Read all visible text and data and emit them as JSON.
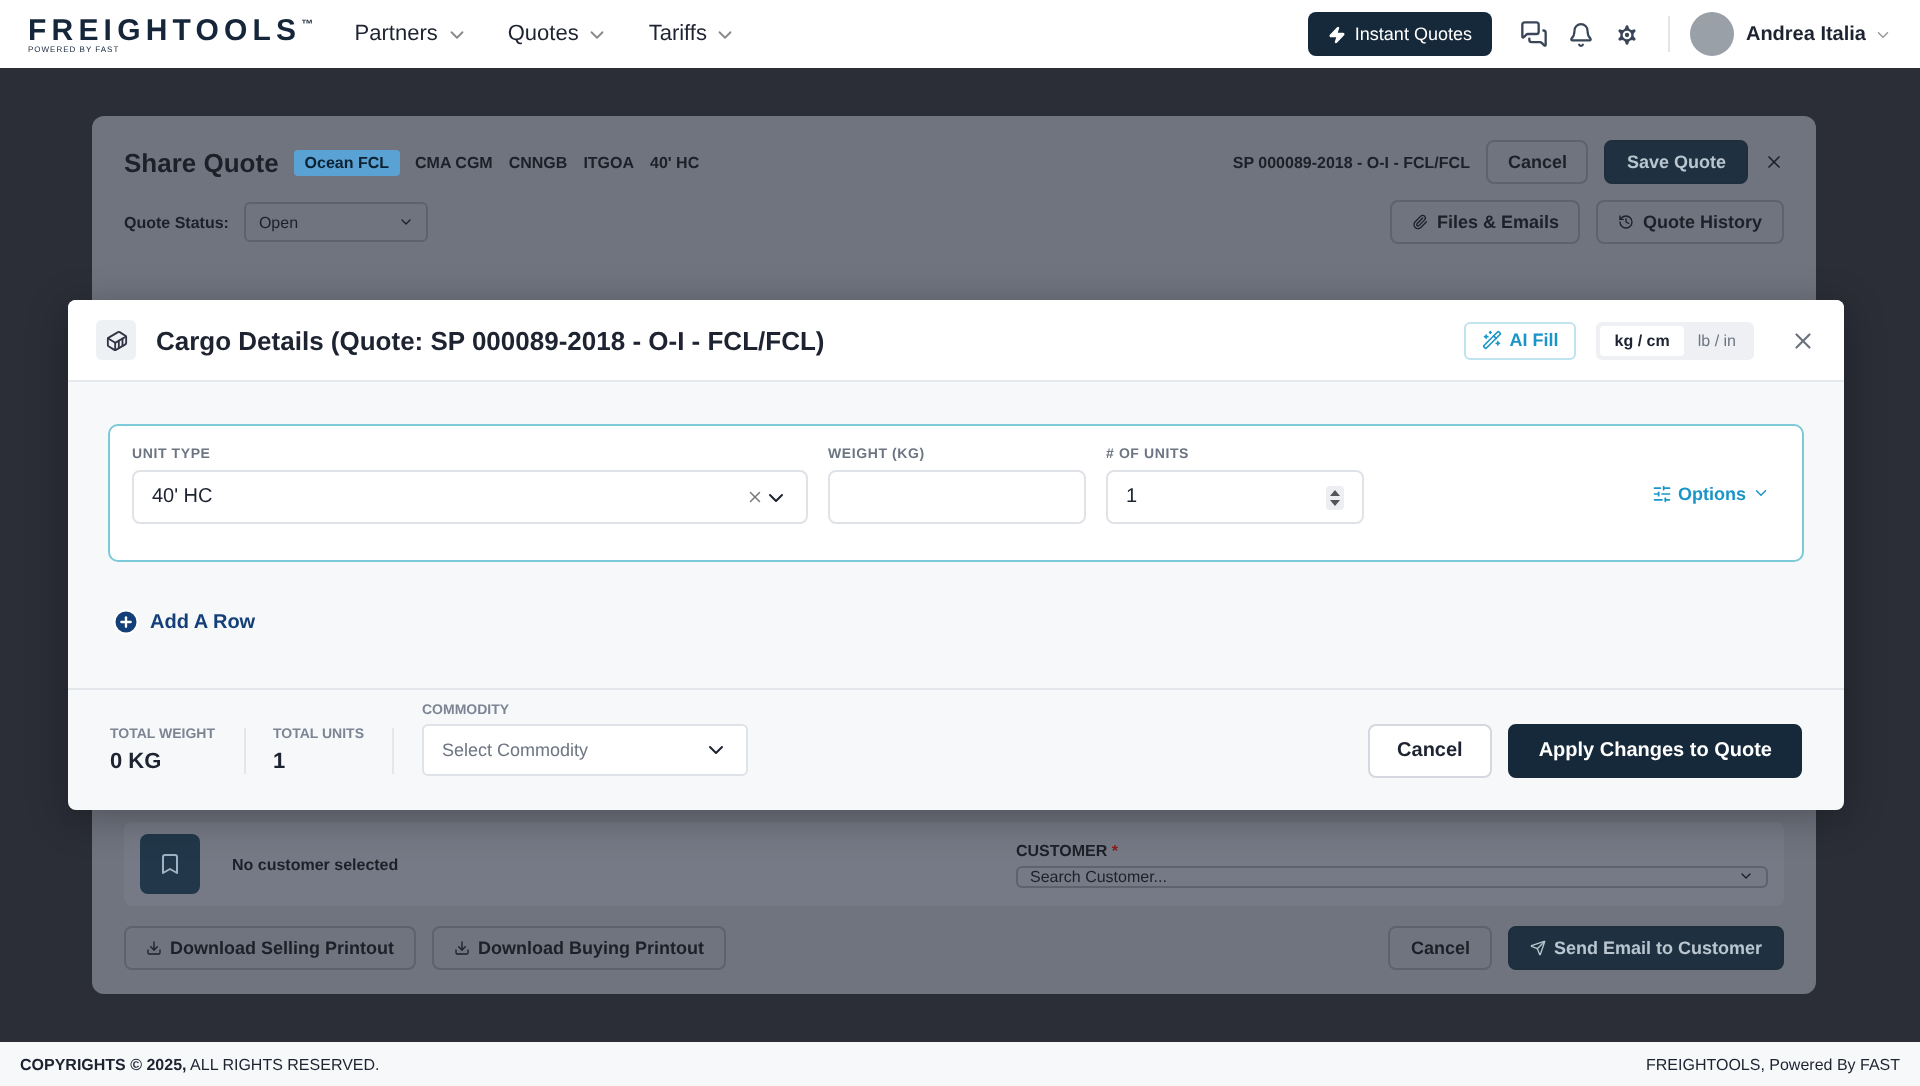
{
  "nav": {
    "logo": "FREIGHTOOLS",
    "logo_tm": "™",
    "logo_sub": "POWERED BY FAST",
    "menus": [
      "Partners",
      "Quotes",
      "Tariffs"
    ],
    "instant_button": "Instant Quotes",
    "user": "Andrea Italia"
  },
  "background": {
    "title": "Share Quote",
    "mode_badge": "Ocean FCL",
    "route": [
      "CMA CGM",
      "CNNGB",
      "ITGOA",
      "40' HC"
    ],
    "quote_ref": "SP 000089-2018 - O-I - FCL/FCL",
    "cancel": "Cancel",
    "save": "Save Quote",
    "status_label": "Quote Status:",
    "status_value": "Open",
    "files": "Files & Emails",
    "history": "Quote History",
    "no_customer": "No customer selected",
    "customer_label": "CUSTOMER",
    "customer_required": "*",
    "customer_placeholder": "Search Customer...",
    "download_selling": "Download Selling Printout",
    "download_buying": "Download Buying Printout",
    "cancel_bottom": "Cancel",
    "send": "Send Email to Customer"
  },
  "modal": {
    "title": "Cargo Details (Quote: SP 000089-2018 - O-I - FCL/FCL)",
    "ai_fill": "AI Fill",
    "units_toggle": [
      {
        "label": "kg / cm",
        "selected": true
      },
      {
        "label": "lb / in",
        "selected": false
      }
    ],
    "rows": [
      {
        "unit_type_label": "UNIT TYPE",
        "unit_type": "40' HC",
        "weight_label": "WEIGHT (KG)",
        "weight": "",
        "count_label": "# OF UNITS",
        "count": "1",
        "options": "Options"
      }
    ],
    "add_row": "Add A Row",
    "footer": {
      "total_weight_label": "TOTAL WEIGHT",
      "total_weight": "0 KG",
      "total_units_label": "TOTAL UNITS",
      "total_units": "1",
      "commodity_label": "COMMODITY",
      "commodity_placeholder": "Select Commodity",
      "cancel": "Cancel",
      "apply": "Apply Changes to Quote"
    }
  },
  "footer": {
    "copyright_bold": "COPYRIGHTS © 2025,",
    "copyright_rest": "ALL RIGHTS RESERVED.",
    "credit": "FREIGHTOOLS, Powered By FAST"
  }
}
